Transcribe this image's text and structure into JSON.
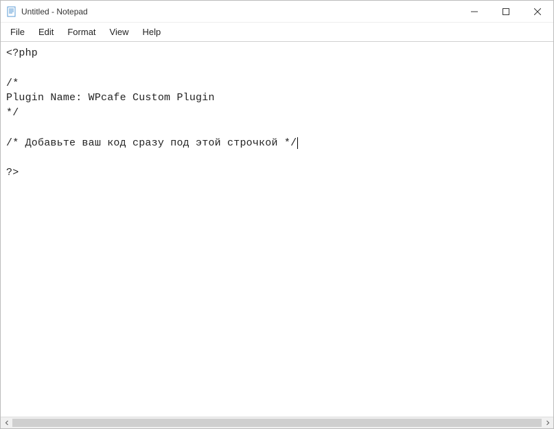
{
  "window": {
    "title": "Untitled - Notepad"
  },
  "menubar": {
    "items": [
      "File",
      "Edit",
      "Format",
      "View",
      "Help"
    ]
  },
  "editor": {
    "content": "<?php\n\n/*\nPlugin Name: WPcafe Custom Plugin\n*/\n\n/* Добавьте ваш код сразу под этой строчкой */\n\n?>"
  }
}
